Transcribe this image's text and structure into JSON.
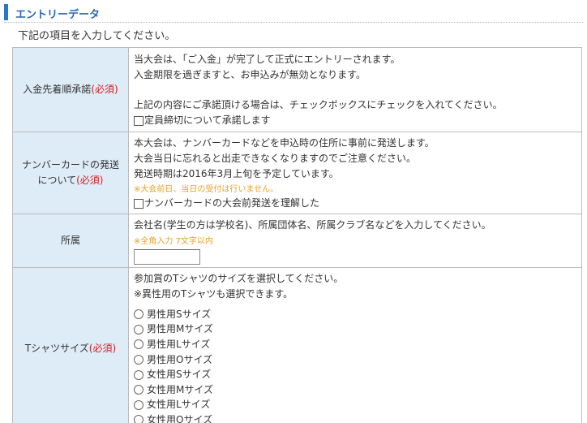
{
  "section": {
    "title": "エントリーデータ",
    "intro": "下記の項目を入力してください。"
  },
  "rows": {
    "payment": {
      "label": "入金先着順承諾",
      "required": "(必須)",
      "lines": [
        "当大会は、「ご入金」が完了して正式にエントリーされます。",
        "入金期限を過ぎますと、お申込みが無効となります。",
        "上記の内容にご承諾頂ける場合は、チェックボックスにチェックを入れてください。"
      ],
      "checkbox_label": "定員締切について承諾します"
    },
    "number_card": {
      "label_line1": "ナンバーカードの発送",
      "label_line2": "について",
      "required": "(必須)",
      "lines": [
        "本大会は、ナンバーカードなどを申込時の住所に事前に発送します。",
        "大会当日に忘れると出走できなくなりますのでご注意ください。",
        "発送時期は2016年3月上旬を予定しています。"
      ],
      "note": "※大会前日、当日の受付は行いません。",
      "checkbox_label": "ナンバーカードの大会前発送を理解した"
    },
    "affiliation": {
      "label": "所属",
      "description": "会社名(学生の方は学校名)、所属団体名、所属クラブ名などを入力してください。",
      "note": "※全角入力 7文字以内",
      "input_value": ""
    },
    "tshirt": {
      "label": "Tシャツサイズ",
      "required": "(必須)",
      "lines": [
        "参加賞のTシャツのサイズを選択してください。",
        "※異性用のTシャツも選択できます。"
      ],
      "options": [
        "男性用Sサイズ",
        "男性用Mサイズ",
        "男性用Lサイズ",
        "男性用Oサイズ",
        "女性用Sサイズ",
        "女性用Mサイズ",
        "女性用Lサイズ",
        "女性用Oサイズ"
      ]
    }
  }
}
